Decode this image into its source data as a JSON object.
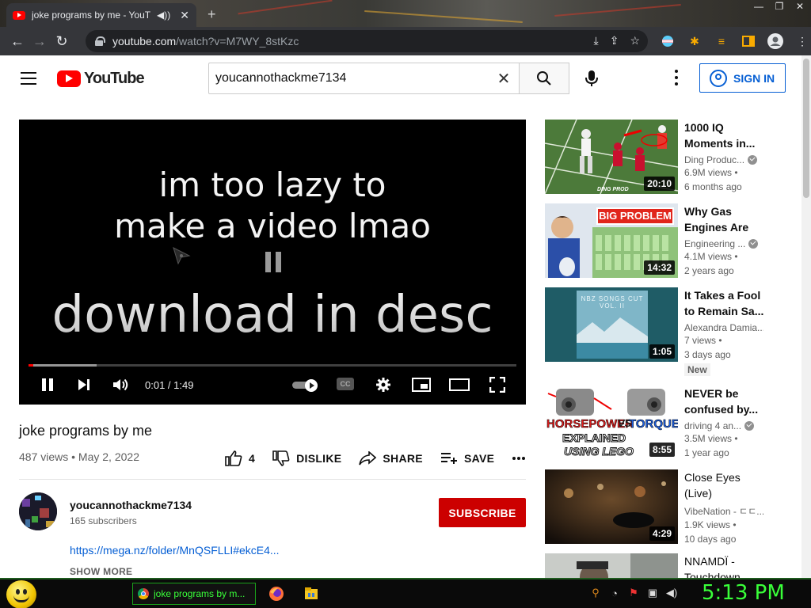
{
  "browser": {
    "tab_title": "joke programs by me - YouT",
    "url_host": "youtube.com",
    "url_path": "/watch?v=M7WY_8stKzc"
  },
  "youtube": {
    "logo_text": "YouTube",
    "search_query": "youcannothackme7134",
    "sign_in_label": "SIGN IN"
  },
  "player": {
    "line1": "im too lazy to",
    "line2": "make a video lmao",
    "line3": "download in desc",
    "timecode": "0:01 / 1:49",
    "progress_played": 0.01,
    "progress_loaded": 0.14
  },
  "video": {
    "title": "joke programs by me",
    "meta": "487 views • May 2, 2022",
    "likes": "4",
    "dislike_label": "DISLIKE",
    "share_label": "SHARE",
    "save_label": "SAVE"
  },
  "channel": {
    "name": "youcannothackme7134",
    "subscribers": "165 subscribers",
    "subscribe_label": "SUBSCRIBE",
    "description_link": "https://mega.nz/folder/MnQSFLLI#ekcE4...",
    "show_more": "SHOW MORE"
  },
  "recommendations": [
    {
      "title": "1000 IQ Moments in...",
      "channel": "Ding Produc...",
      "verified": true,
      "views": "6.9M views •",
      "age": "6 months ago",
      "duration": "20:10",
      "badge": ""
    },
    {
      "title": "Why Gas Engines Are F...",
      "channel": "Engineering ...",
      "verified": true,
      "views": "4.1M views •",
      "age": "2 years ago",
      "duration": "14:32",
      "badge": ""
    },
    {
      "title": "It Takes a Fool to Remain Sa...",
      "channel": "Alexandra Damia...",
      "verified": false,
      "views": "7 views •",
      "age": "3 days ago",
      "duration": "1:05",
      "badge": "New"
    },
    {
      "title": "NEVER be confused by...",
      "channel": "driving 4 an...",
      "verified": true,
      "views": "3.5M views •",
      "age": "1 year ago",
      "duration": "8:55",
      "badge": ""
    },
    {
      "title": "Close Eyes (Live)",
      "channel": "VibeNation - ㄷㄷ...",
      "verified": false,
      "views": "1.9K views •",
      "age": "10 days ago",
      "duration": "4:29",
      "badge": ""
    },
    {
      "title": "NNAMDÏ - Touchdown",
      "channel": "",
      "verified": false,
      "views": "",
      "age": "",
      "duration": "",
      "badge": ""
    }
  ],
  "thumb_text": {
    "rec1_tag": "DING PROD",
    "rec2_banner": "BIG PROBLEM",
    "rec3_banner": "NBZ SONGS CUT VOL. II",
    "rec4_line1": "HORSEPOWER",
    "rec4_vs": "VS",
    "rec4_line2": "TORQUE",
    "rec4_line3": "EXPLAINED",
    "rec4_line4": "USING LEGO"
  },
  "taskbar": {
    "task_label": "joke programs by m...",
    "clock": "5:13 PM"
  },
  "colors": {
    "youtube_red": "#ff0000",
    "subscribe_red": "#cc0000",
    "link_blue": "#065fd4",
    "taskbar_green": "#39ff39"
  }
}
